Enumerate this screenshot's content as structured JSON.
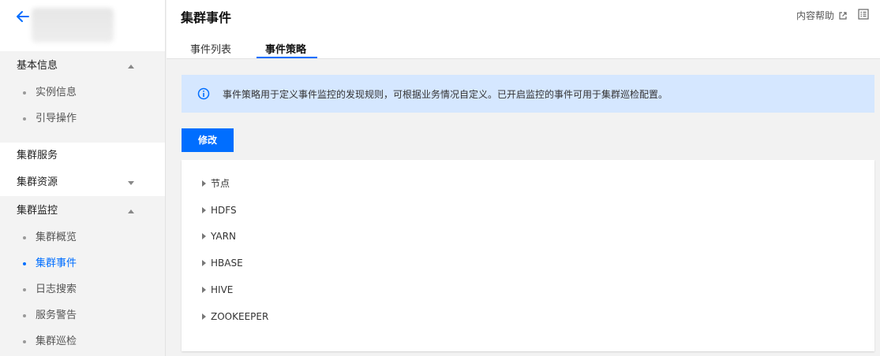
{
  "sidebar": {
    "groups": [
      {
        "label": "基本信息",
        "expanded": true,
        "items": [
          "实例信息",
          "引导操作"
        ]
      },
      {
        "label": "集群服务"
      },
      {
        "label": "集群资源",
        "expanded": false
      },
      {
        "label": "集群监控",
        "expanded": true,
        "items": [
          "集群概览",
          "集群事件",
          "日志搜索",
          "服务警告",
          "集群巡检"
        ],
        "active_item": "集群事件"
      }
    ]
  },
  "header": {
    "title": "集群事件",
    "help_label": "内容帮助",
    "tabs": [
      {
        "label": "事件列表",
        "active": false
      },
      {
        "label": "事件策略",
        "active": true
      }
    ]
  },
  "info_banner": {
    "text": "事件策略用于定义事件监控的发现规则，可根据业务情况自定义。已开启监控的事件可用于集群巡检配置。"
  },
  "toolbar": {
    "modify_label": "修改"
  },
  "tree": {
    "items": [
      "节点",
      "HDFS",
      "YARN",
      "HBASE",
      "HIVE",
      "ZOOKEEPER"
    ]
  },
  "colors": {
    "accent": "#006eff",
    "info_bg": "#d5e7ff"
  }
}
